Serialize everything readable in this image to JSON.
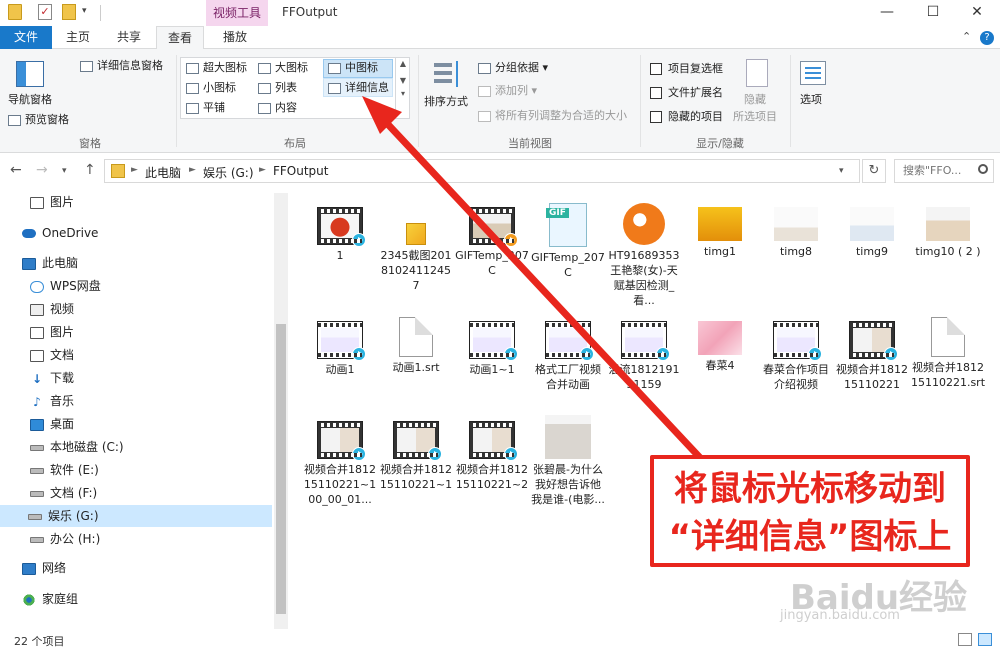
{
  "window": {
    "title": "FFOutput",
    "context_tab": "视频工具",
    "controls": [
      "minimize-icon",
      "maximize-icon",
      "close-icon"
    ]
  },
  "ribbon_tabs": {
    "file": "文件",
    "home": "主页",
    "share": "共享",
    "view": "查看",
    "play": "播放"
  },
  "ribbon": {
    "panes": {
      "nav_pane": "导航窗格",
      "preview_pane": "预览窗格",
      "details_pane": "详细信息窗格",
      "group_label": "窗格"
    },
    "layout": {
      "extra_large": "超大图标",
      "large": "大图标",
      "medium": "中图标",
      "small": "小图标",
      "list": "列表",
      "details": "详细信息",
      "tiles": "平铺",
      "content": "内容",
      "group_label": "布局"
    },
    "current_view": {
      "sort_by": "排序方式",
      "group_by": "分组依据",
      "add_columns": "添加列",
      "size_all_columns": "将所有列调整为合适的大小",
      "group_label": "当前视图"
    },
    "show_hide": {
      "item_checkboxes": "项目复选框",
      "file_extensions": "文件扩展名",
      "hidden_items": "隐藏的项目",
      "hide_selected_1": "隐藏",
      "hide_selected_2": "所选项目",
      "group_label": "显示/隐藏"
    },
    "options": "选项"
  },
  "address_bar": {
    "crumbs": [
      "此电脑",
      "娱乐 (G:)",
      "FFOutput"
    ],
    "search_placeholder": "搜索\"FFO..."
  },
  "nav_pane": {
    "items": [
      {
        "label": "图片",
        "icon": "pictures-icon"
      },
      {
        "label": "OneDrive",
        "icon": "onedrive-icon"
      },
      {
        "label": "此电脑",
        "icon": "computer-icon"
      },
      {
        "label": "WPS网盘",
        "icon": "cloud-icon"
      },
      {
        "label": "视频",
        "icon": "videos-icon"
      },
      {
        "label": "图片",
        "icon": "pictures-icon"
      },
      {
        "label": "文档",
        "icon": "documents-icon"
      },
      {
        "label": "下载",
        "icon": "download-icon"
      },
      {
        "label": "音乐",
        "icon": "music-icon"
      },
      {
        "label": "桌面",
        "icon": "desktop-icon"
      },
      {
        "label": "本地磁盘 (C:)",
        "icon": "drive-icon"
      },
      {
        "label": "软件 (E:)",
        "icon": "drive-icon"
      },
      {
        "label": "文档 (F:)",
        "icon": "drive-icon"
      },
      {
        "label": "娱乐 (G:)",
        "icon": "drive-icon",
        "selected": true
      },
      {
        "label": "办公 (H:)",
        "icon": "drive-icon"
      },
      {
        "label": "网络",
        "icon": "network-icon"
      },
      {
        "label": "家庭组",
        "icon": "homegroup-icon"
      }
    ]
  },
  "files": [
    {
      "name": "1",
      "kind": "video-tomato"
    },
    {
      "name": "2345截图20181024112457",
      "kind": "image-small"
    },
    {
      "name": "GIFTemp_207C",
      "kind": "video-dog"
    },
    {
      "name": "GIFTemp_207C",
      "kind": "gif"
    },
    {
      "name": "HT91689353王艳黎(女)-天赋基因检测_看...",
      "kind": "app-orange"
    },
    {
      "name": "timg1",
      "kind": "image-yellow"
    },
    {
      "name": "timg8",
      "kind": "image-chef"
    },
    {
      "name": "timg9",
      "kind": "image-doctor"
    },
    {
      "name": "timg10 ( 2 )",
      "kind": "image-dog"
    },
    {
      "name": "动画1",
      "kind": "video-anim"
    },
    {
      "name": "动画1.srt",
      "kind": "doc"
    },
    {
      "name": "动画1~1",
      "kind": "video-anim"
    },
    {
      "name": "格式工厂视频合并动画",
      "kind": "video-anim"
    },
    {
      "name": "混流181219151159",
      "kind": "video-anim"
    },
    {
      "name": "春菜4",
      "kind": "image-pink"
    },
    {
      "name": "春菜合作项目介绍视频",
      "kind": "video-anim"
    },
    {
      "name": "视频合并181215110221",
      "kind": "video-woman"
    },
    {
      "name": "视频合并181215110221.srt",
      "kind": "doc"
    },
    {
      "name": "视频合并181215110221~100_00_01...",
      "kind": "video-woman"
    },
    {
      "name": "视频合并181215110221~1",
      "kind": "video-woman"
    },
    {
      "name": "视频合并181215110221~2",
      "kind": "video-woman"
    },
    {
      "name": "张碧晨-为什么我好想告诉他我是谁-(电影...",
      "kind": "image-portrait"
    }
  ],
  "status": {
    "item_count": "22 个项目"
  },
  "annotation": {
    "line1": "将鼠标光标移动到",
    "line2": "“详细信息”图标上",
    "color": "#e8261d"
  },
  "watermark": {
    "brand": "Baidu经验",
    "url": "jingyan.baidu.com"
  },
  "colors": {
    "accent": "#1979ca",
    "selection": "#cce8ff",
    "context_tab": "#f5d6ee"
  }
}
